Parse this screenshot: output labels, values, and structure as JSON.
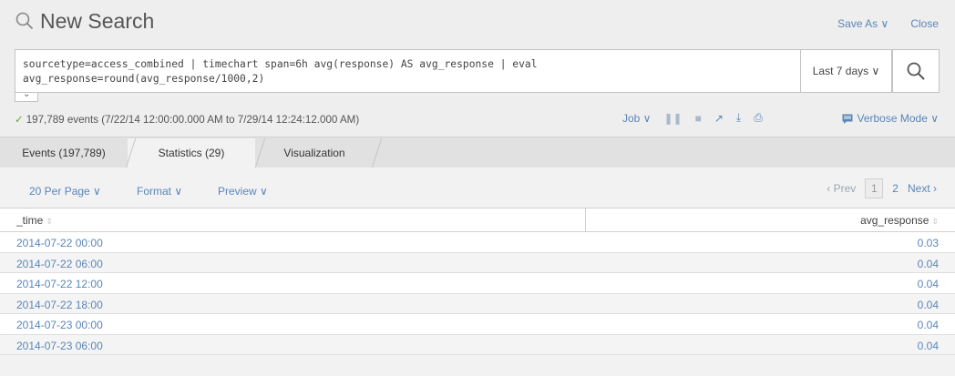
{
  "header": {
    "title": "New Search",
    "save_as": "Save As ∨",
    "close": "Close"
  },
  "search": {
    "query": "sourcetype=access_combined | timechart span=6h avg(response) AS avg_response | eval\navg_response=round(avg_response/1000,2)",
    "time_range": "Last 7 days ∨"
  },
  "status": {
    "text": "197,789 events (7/22/14 12:00:00.000 AM to 7/29/14 12:24:12.000 AM)",
    "job": "Job ∨",
    "mode": "Verbose Mode ∨"
  },
  "tabs": [
    {
      "label": "Events (197,789)"
    },
    {
      "label": "Statistics (29)"
    },
    {
      "label": "Visualization"
    }
  ],
  "controls": {
    "per_page": "20 Per Page ∨",
    "format": "Format ∨",
    "preview": "Preview ∨"
  },
  "pager": {
    "prev": "‹ Prev",
    "current": "1",
    "page2": "2",
    "next": "Next ›"
  },
  "table": {
    "columns": [
      "_time",
      "avg_response"
    ],
    "rows": [
      {
        "time": "2014-07-22 00:00",
        "value": "0.03"
      },
      {
        "time": "2014-07-22 06:00",
        "value": "0.04"
      },
      {
        "time": "2014-07-22 12:00",
        "value": "0.04"
      },
      {
        "time": "2014-07-22 18:00",
        "value": "0.04"
      },
      {
        "time": "2014-07-23 00:00",
        "value": "0.04"
      },
      {
        "time": "2014-07-23 06:00",
        "value": "0.04"
      }
    ]
  },
  "colors": {
    "link": "#5a86b8",
    "success": "#65a637",
    "background": "#eeeeee"
  }
}
